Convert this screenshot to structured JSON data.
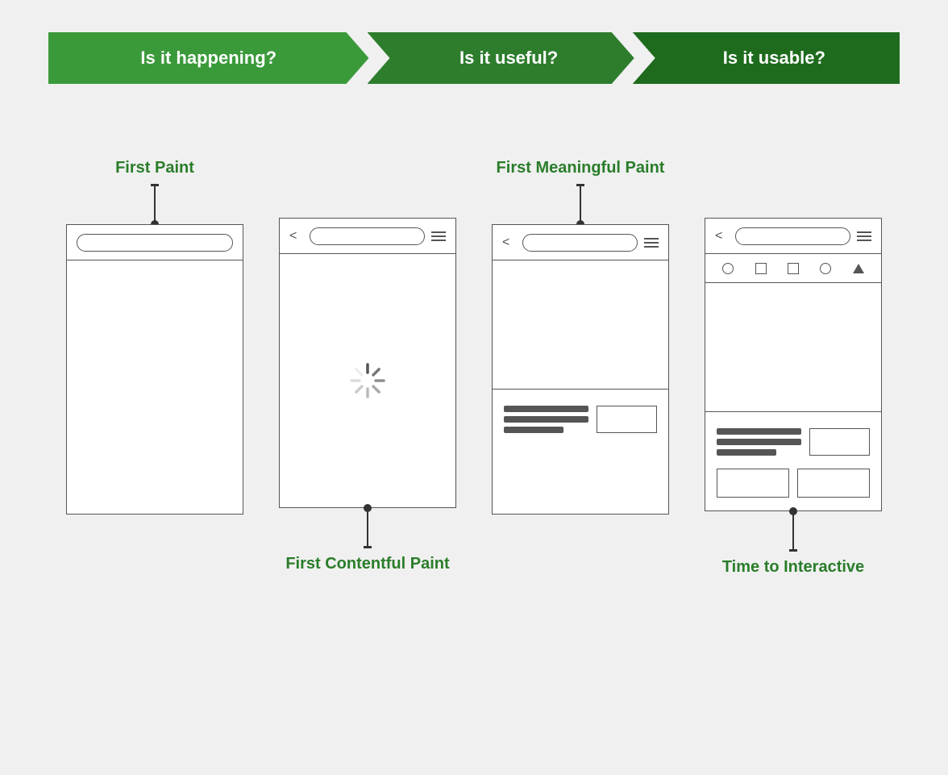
{
  "banner": {
    "segment1_label": "Is it happening?",
    "segment2_label": "Is it useful?",
    "segment3_label": "Is it usable?"
  },
  "labels": {
    "first_paint": "First Paint",
    "first_contentful_paint": "First Contentful Paint",
    "first_meaningful_paint": "First Meaningful Paint",
    "time_to_interactive": "Time to Interactive"
  },
  "colors": {
    "green_light": "#3a9a3a",
    "green_mid": "#2d7d2d",
    "green_dark": "#1e6b1e",
    "label_green": "#2a7d2a"
  }
}
